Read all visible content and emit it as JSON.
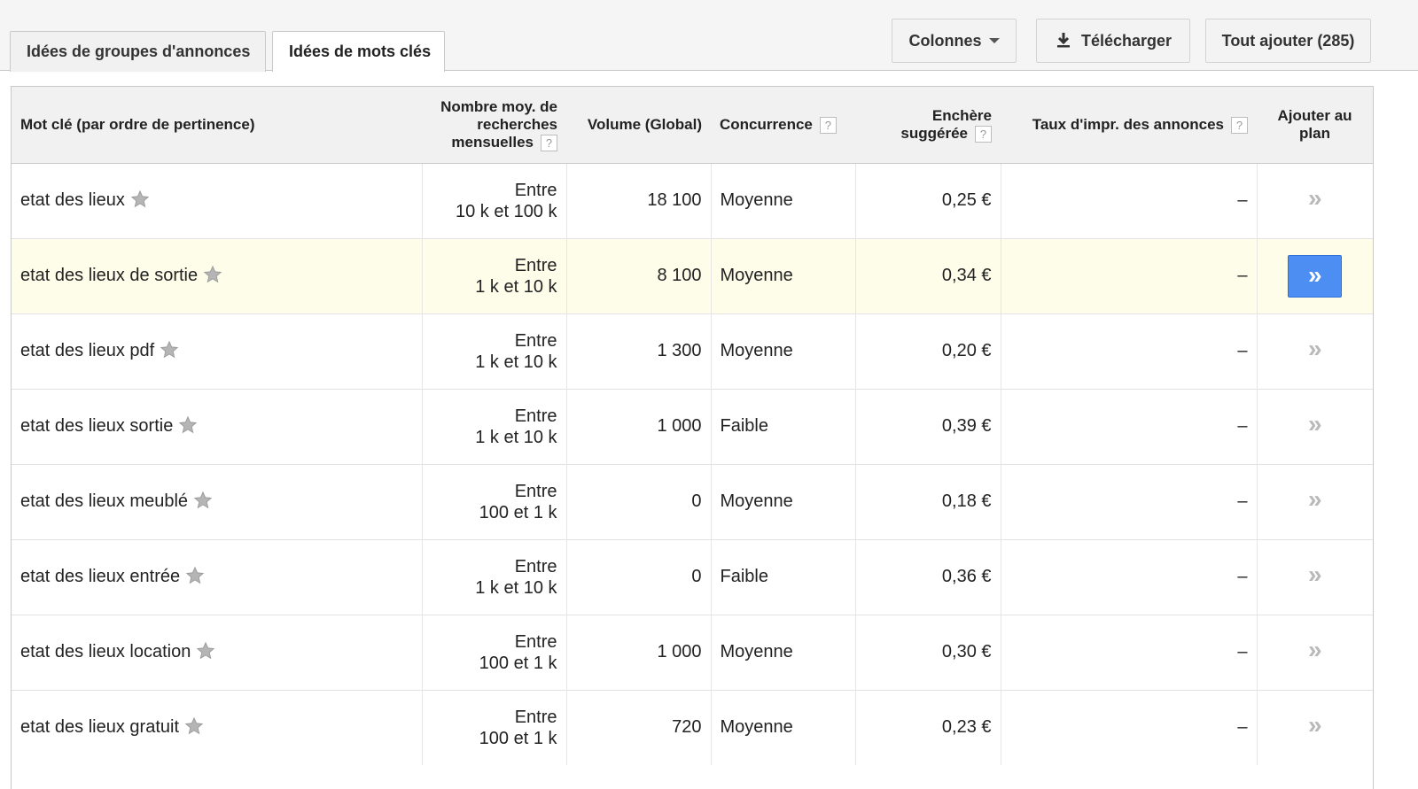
{
  "tabs": [
    {
      "label": "Idées de groupes d'annonces",
      "active": false
    },
    {
      "label": "Idées de mots clés",
      "active": true
    }
  ],
  "toolbar": {
    "columns_label": "Colonnes",
    "download_label": "Télécharger",
    "add_all_label": "Tout ajouter (285)"
  },
  "table": {
    "headers": {
      "keyword": "Mot clé (par ordre de pertinence)",
      "avg_searches_line1": "Nombre moy. de",
      "avg_searches_line2": "recherches",
      "avg_searches_line3": "mensuelles",
      "volume": "Volume (Global)",
      "competition": "Concurrence",
      "bid_line1": "Enchère",
      "bid_line2": "suggérée",
      "impr": "Taux d'impr. des annonces",
      "add_line1": "Ajouter au",
      "add_line2": "plan",
      "help": "?"
    },
    "rows": [
      {
        "keyword": "etat des lieux",
        "range1": "Entre",
        "range2": "10 k et 100 k",
        "volume": "18 100",
        "competition": "Moyenne",
        "bid": "0,25 €",
        "impr": "–",
        "add": "»"
      },
      {
        "keyword": "etat des lieux de sortie",
        "range1": "Entre",
        "range2": "1 k et 10 k",
        "volume": "8 100",
        "competition": "Moyenne",
        "bid": "0,34 €",
        "impr": "–",
        "add": "»"
      },
      {
        "keyword": "etat des lieux pdf",
        "range1": "Entre",
        "range2": "1 k et 10 k",
        "volume": "1 300",
        "competition": "Moyenne",
        "bid": "0,20 €",
        "impr": "–",
        "add": "»"
      },
      {
        "keyword": "etat des lieux sortie",
        "range1": "Entre",
        "range2": "1 k et 10 k",
        "volume": "1 000",
        "competition": "Faible",
        "bid": "0,39 €",
        "impr": "–",
        "add": "»"
      },
      {
        "keyword": "etat des lieux meublé",
        "range1": "Entre",
        "range2": "100 et 1 k",
        "volume": "0",
        "competition": "Moyenne",
        "bid": "0,18 €",
        "impr": "–",
        "add": "»"
      },
      {
        "keyword": "etat des lieux entrée",
        "range1": "Entre",
        "range2": "1 k et 10 k",
        "volume": "0",
        "competition": "Faible",
        "bid": "0,36 €",
        "impr": "–",
        "add": "»"
      },
      {
        "keyword": "etat des lieux location",
        "range1": "Entre",
        "range2": "100 et 1 k",
        "volume": "1 000",
        "competition": "Moyenne",
        "bid": "0,30 €",
        "impr": "–",
        "add": "»"
      },
      {
        "keyword": "etat des lieux gratuit",
        "range1": "Entre",
        "range2": "100 et 1 k",
        "volume": "720",
        "competition": "Moyenne",
        "bid": "0,23 €",
        "impr": "–",
        "add": "»"
      }
    ],
    "highlighted_row": 1
  },
  "colors": {
    "add_button": "#4d8ef2",
    "highlight_row": "#fdfde9"
  }
}
